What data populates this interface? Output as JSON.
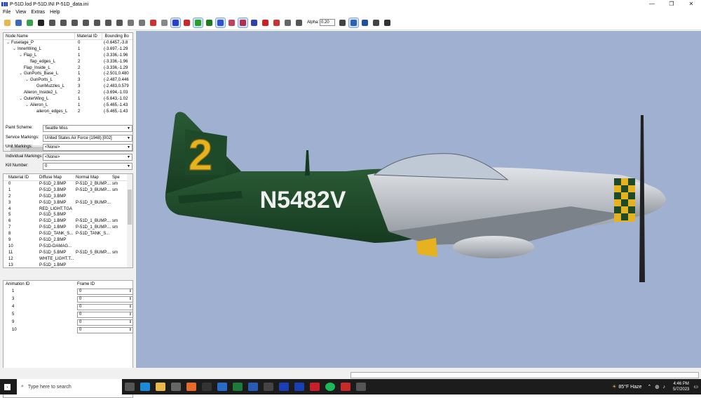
{
  "window": {
    "title": "P-51D.lod  P-51D.INI  P-51D_data.ini",
    "minimize": "—",
    "restore": "❐",
    "close": "✕"
  },
  "menu": [
    "File",
    "View",
    "Extras",
    "Help"
  ],
  "toolbar": {
    "icons": [
      {
        "name": "open-icon",
        "color": "#e8b84a"
      },
      {
        "name": "save-icon",
        "color": "#3a6ab8"
      },
      {
        "name": "texture-icon",
        "color": "#3aa14a"
      },
      {
        "name": "zoom-icon",
        "color": "#222222"
      },
      {
        "name": "box-front-icon",
        "color": "#555555"
      },
      {
        "name": "box-back-icon",
        "color": "#555555"
      },
      {
        "name": "box-left-icon",
        "color": "#555555"
      },
      {
        "name": "box-right-icon",
        "color": "#555555"
      },
      {
        "name": "box-top-icon",
        "color": "#555555"
      },
      {
        "name": "box-bottom-icon",
        "color": "#555555"
      },
      {
        "name": "box-iso-icon",
        "color": "#555555"
      },
      {
        "name": "cube-gray-1-icon",
        "color": "#777777"
      },
      {
        "name": "cube-gray-2-icon",
        "color": "#777777"
      },
      {
        "name": "cube-red-icon",
        "color": "#d23030"
      },
      {
        "name": "cube-gray-3-icon",
        "color": "#888888"
      },
      {
        "name": "view-blue-1-icon",
        "color": "#2a40c8"
      },
      {
        "name": "view-red-icon",
        "color": "#c82a2a"
      },
      {
        "name": "view-green-icon",
        "color": "#2aa02a"
      },
      {
        "name": "view-green-2-icon",
        "color": "#1d7a1d"
      },
      {
        "name": "view-blue-2-icon",
        "color": "#3050d0"
      },
      {
        "name": "shade-1-icon",
        "color": "#c04060"
      },
      {
        "name": "shade-2-icon",
        "color": "#b03050"
      },
      {
        "name": "shade-3-icon",
        "color": "#3040b0"
      },
      {
        "name": "light-icon",
        "color": "#cc2222"
      },
      {
        "name": "sphere-icon",
        "color": "#cc3333"
      },
      {
        "name": "object-icon",
        "color": "#666666"
      },
      {
        "name": "solid-icon",
        "color": "#555555"
      }
    ],
    "alpha_label": "Alpha:",
    "alpha_value": "0.20",
    "icons_after": [
      {
        "name": "wire-box-icon",
        "color": "#444444"
      },
      {
        "name": "grid-icon",
        "color": "#3060b0"
      },
      {
        "name": "axes-icon",
        "color": "#2050a0"
      },
      {
        "name": "cube-outline-icon",
        "color": "#444444"
      },
      {
        "name": "tools-icon",
        "color": "#333333"
      }
    ]
  },
  "tree": {
    "columns": [
      "Node Name",
      "Material ID",
      "Bounding Bo"
    ],
    "rows": [
      {
        "toggle": "⌄",
        "indent": 0,
        "name": "Fuselage_P",
        "mat": "0",
        "bbox": "(-0.6457,-3.8"
      },
      {
        "toggle": "⌄",
        "indent": 1,
        "name": "InnerWing_L",
        "mat": "1",
        "bbox": "(-3.697,-1.29"
      },
      {
        "toggle": "⌄",
        "indent": 2,
        "name": "Flap_L",
        "mat": "1",
        "bbox": "(-3.336,-1.96"
      },
      {
        "toggle": "",
        "indent": 3,
        "name": "flap_edges_L",
        "mat": "2",
        "bbox": "(-3.336,-1.96"
      },
      {
        "toggle": "",
        "indent": 2,
        "name": "Flap_Inside_L",
        "mat": "2",
        "bbox": "(-3.336,-1.29"
      },
      {
        "toggle": "⌄",
        "indent": 2,
        "name": "GunPorts_Base_L",
        "mat": "1",
        "bbox": "(-2.501,0.480"
      },
      {
        "toggle": "⌄",
        "indent": 3,
        "name": "GunPorts_L",
        "mat": "3",
        "bbox": "(-2.487,0.446"
      },
      {
        "toggle": "",
        "indent": 4,
        "name": "GunMuzzles_L",
        "mat": "3",
        "bbox": "(-2.483,0.579"
      },
      {
        "toggle": "",
        "indent": 2,
        "name": "Aileron_Inside2_L",
        "mat": "2",
        "bbox": "(-3.694,-1.03"
      },
      {
        "toggle": "⌄",
        "indent": 2,
        "name": "OuterWing_L",
        "mat": "1",
        "bbox": "(-5.643,-1.02"
      },
      {
        "toggle": "⌄",
        "indent": 3,
        "name": "Aileron_L",
        "mat": "1",
        "bbox": "(-5.465,-1.43"
      },
      {
        "toggle": "",
        "indent": 4,
        "name": "aileron_edges_L",
        "mat": "2",
        "bbox": "(-5.465,-1.43"
      }
    ]
  },
  "form": {
    "paint_label": "Paint Scheme:",
    "paint_value": "Seattle Miss",
    "service_label": "Service Markings:",
    "service_value": "United States Air Force (1948) [002]",
    "unit_label": "Unit Markings:",
    "unit_value": "<None>",
    "individual_label": "Individual Markings:",
    "individual_value": "<None>",
    "kill_label": "Kill Number:",
    "kill_value": "0"
  },
  "materials": {
    "columns": [
      "Material ID",
      "Diffuse Map",
      "Normal Map",
      "Spe"
    ],
    "rows": [
      [
        "0",
        "P-51D_2.BMP",
        "P-51D_2_BUMP....",
        "sm"
      ],
      [
        "1",
        "P-51D_3.BMP",
        "P-51D_3_BUMP....",
        "sm"
      ],
      [
        "2",
        "P-51D_3.BMP",
        "",
        ""
      ],
      [
        "3",
        "P-51D_3.BMP",
        "P-51D_3_BUMP....",
        ""
      ],
      [
        "4",
        "RED_LIGHT.TGA",
        "",
        ""
      ],
      [
        "5",
        "P-51D_5.BMP",
        "",
        ""
      ],
      [
        "6",
        "P-51D_1.BMP",
        "P-51D_1_BUMP....",
        "sm"
      ],
      [
        "7",
        "P-51D_1.BMP",
        "P-51D_1_BUMP....",
        "sm"
      ],
      [
        "8",
        "P-51D_TANK_S...",
        "P-51D_TANK_S...",
        ""
      ],
      [
        "9",
        "P-51D_2.BMP",
        "",
        ""
      ],
      [
        "10",
        "P-51D-DAMAG...",
        "",
        ""
      ],
      [
        "11",
        "P-51D_5.BMP",
        "P-51D_5_BUMP....",
        "sm"
      ],
      [
        "12",
        "WHITE_LIGHT.T...",
        "",
        ""
      ],
      [
        "13",
        "P-51D_1.BMP",
        "",
        ""
      ]
    ]
  },
  "animation": {
    "columns": [
      "Animation ID",
      "Frame ID"
    ],
    "rows": [
      [
        "1",
        "0"
      ],
      [
        "3",
        "0"
      ],
      [
        "4",
        "0"
      ],
      [
        "5",
        "0"
      ],
      [
        "9",
        "0"
      ],
      [
        "10",
        "0"
      ]
    ]
  },
  "aircraft": {
    "registration": "N5482V",
    "race_number": "2",
    "body_color": "#1e4a2a",
    "metal_color": "#c8cbd0",
    "accent_color": "#e6b21f"
  },
  "taskbar": {
    "search_placeholder": "Type here to search",
    "weather": "85°F  Haze",
    "time": "4:46 PM",
    "date": "5/7/2023"
  }
}
